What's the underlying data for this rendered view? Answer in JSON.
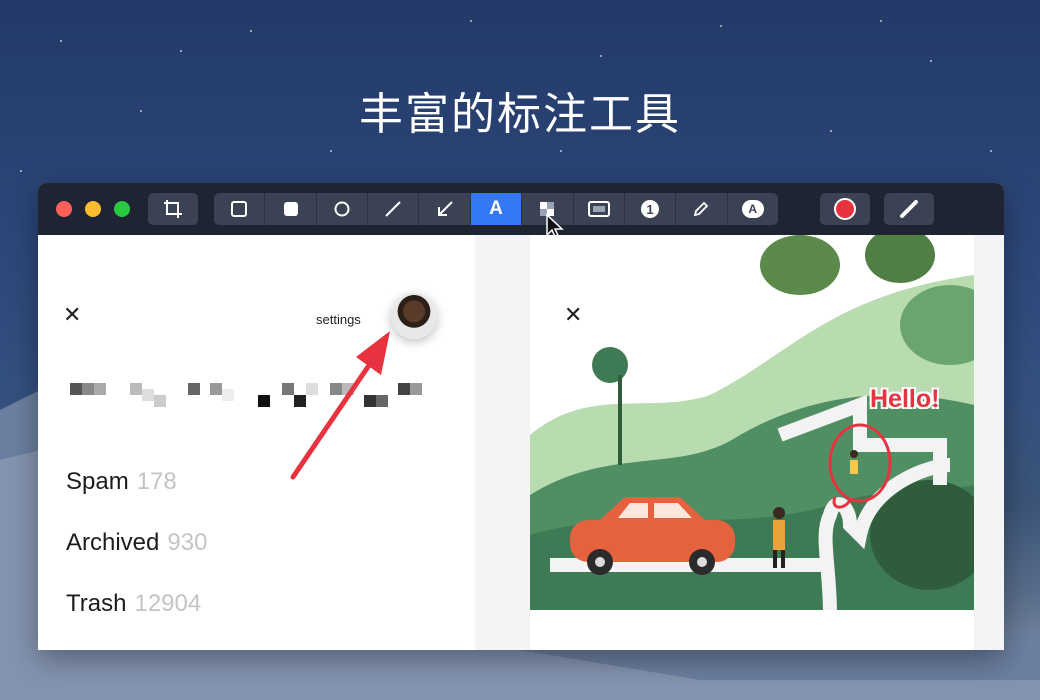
{
  "headline": "丰富的标注工具",
  "window": {
    "traffic_lights": [
      "close",
      "minimize",
      "zoom"
    ],
    "toolbar": {
      "crop_tool": "crop-icon",
      "tools": [
        {
          "name": "rectangle-outline-icon",
          "active": false
        },
        {
          "name": "rectangle-filled-icon",
          "active": false
        },
        {
          "name": "ellipse-icon",
          "active": false
        },
        {
          "name": "line-icon",
          "active": false
        },
        {
          "name": "arrow-icon",
          "active": false
        },
        {
          "name": "text-icon",
          "label": "A",
          "active": true
        },
        {
          "name": "mosaic-icon",
          "active": false
        },
        {
          "name": "highlight-frame-icon",
          "active": false
        },
        {
          "name": "counter-icon",
          "label": "1",
          "active": false
        },
        {
          "name": "pencil-icon",
          "active": false
        },
        {
          "name": "eraser-icon",
          "label": "A",
          "active": false
        }
      ],
      "color_swatch": "#e8323f",
      "stroke_tool": "brush-icon"
    }
  },
  "left_pane": {
    "settings_label": "settings",
    "menu": [
      {
        "label": "Spam",
        "count": "178"
      },
      {
        "label": "Archived",
        "count": "930"
      },
      {
        "label": "Trash",
        "count": "12904"
      }
    ]
  },
  "right_pane": {
    "annotation_text": "Hello!"
  },
  "colors": {
    "accent_blue": "#3478f6",
    "annotation_red": "#e8323f",
    "toolbar_bg": "#1e2432"
  }
}
